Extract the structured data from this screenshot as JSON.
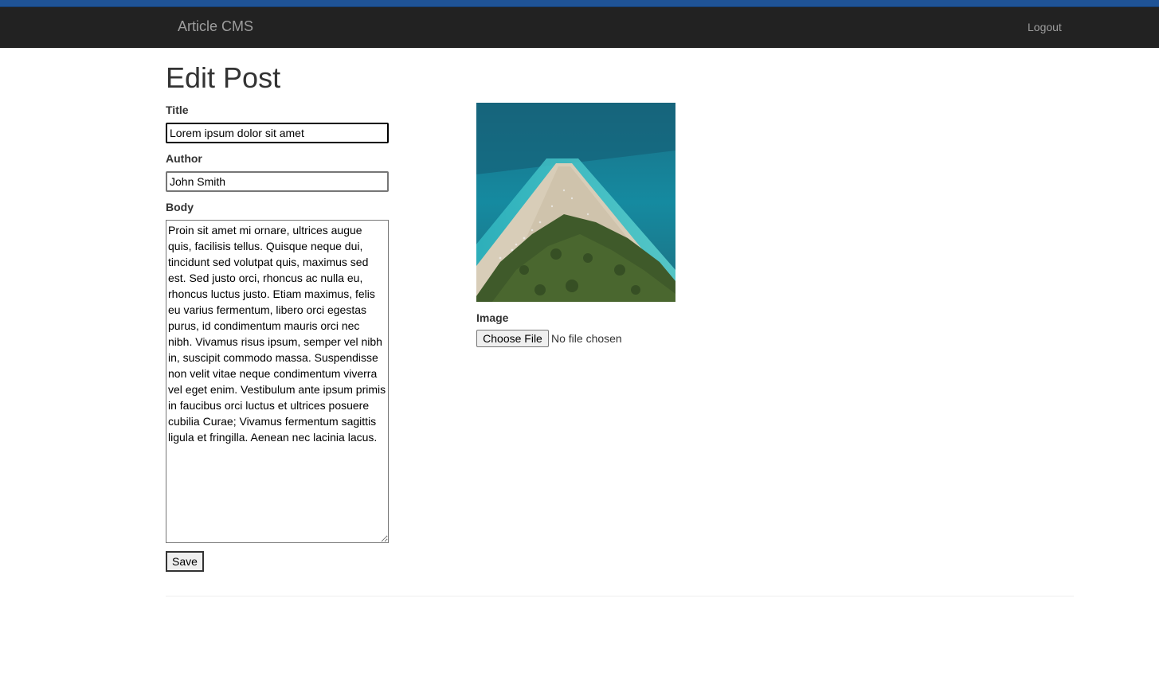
{
  "navbar": {
    "brand": "Article CMS",
    "logout_label": "Logout"
  },
  "page": {
    "heading": "Edit Post"
  },
  "form": {
    "title_label": "Title",
    "title_value": "Lorem ipsum dolor sit amet",
    "author_label": "Author",
    "author_value": "John Smith",
    "body_label": "Body",
    "body_value": "Proin sit amet mi ornare, ultrices augue quis, facilisis tellus. Quisque neque dui, tincidunt sed volutpat quis, maximus sed est. Sed justo orci, rhoncus ac nulla eu, rhoncus luctus justo. Etiam maximus, felis eu varius fermentum, libero orci egestas purus, id condimentum mauris orci nec nibh. Vivamus risus ipsum, semper vel nibh in, suscipit commodo massa. Suspendisse non velit vitae neque condimentum viverra vel eget enim. Vestibulum ante ipsum primis in faucibus orci luctus et ultrices posuere cubilia Curae; Vivamus fermentum sagittis ligula et fringilla. Aenean nec lacinia lacus.",
    "save_label": "Save"
  },
  "image": {
    "label": "Image",
    "choose_file_label": "Choose File",
    "file_status": "No file chosen"
  },
  "colors": {
    "top_strip": "#1f5396",
    "navbar_bg": "#222222",
    "navbar_text": "#9d9d9d"
  }
}
